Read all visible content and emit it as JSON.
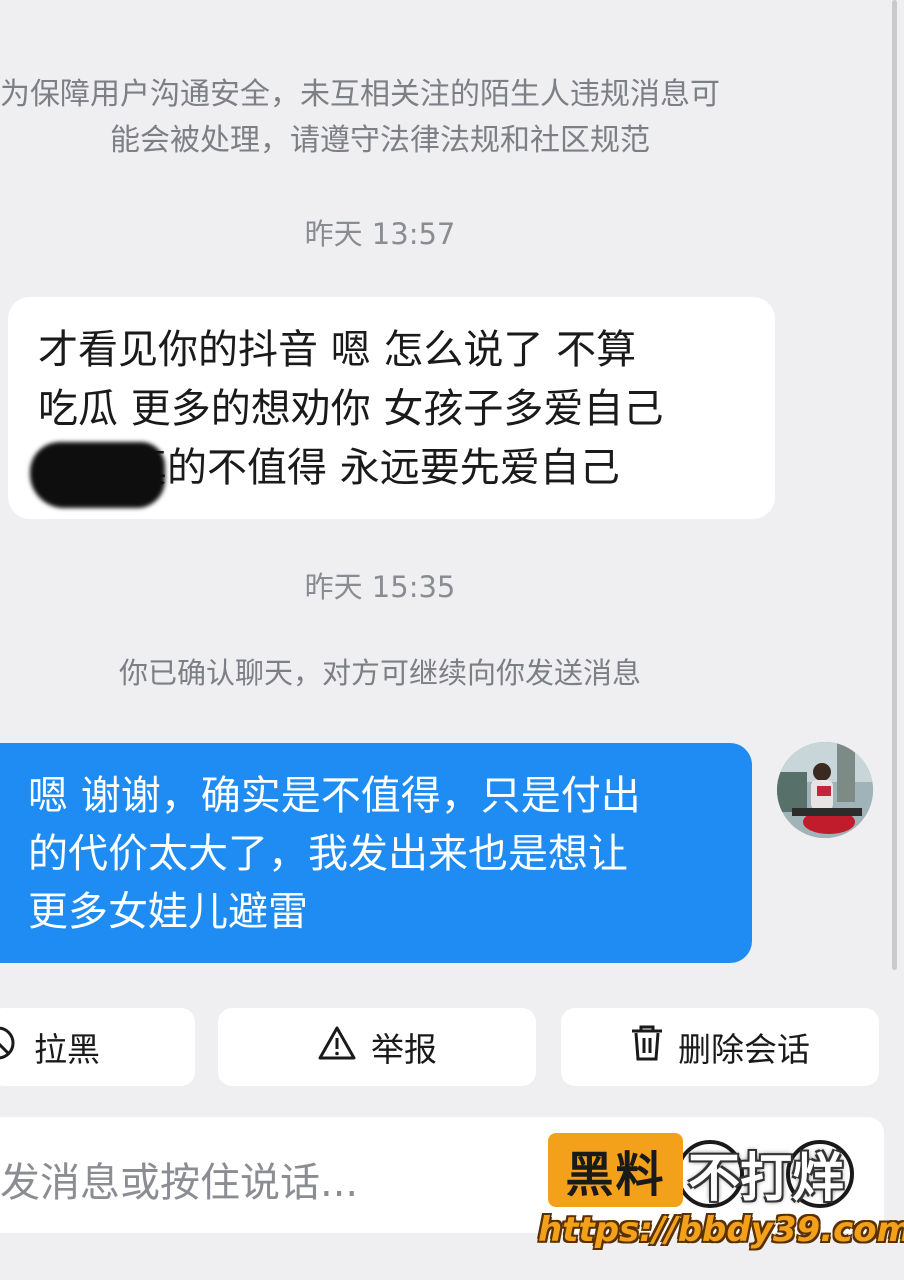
{
  "notice": {
    "line1": "为保障用户沟通安全，未互相关注的陌生人违规消息可",
    "line2": "能会被处理，请遵守法律法规和社区规范"
  },
  "messages": [
    {
      "timestamp": "昨天 13:57",
      "lines": [
        "才看见你的抖音 嗯 怎么说了 不算",
        "吃瓜 更多的想劝你 女孩子多爱自己",
        "       真的不值得 永远要先爱自己"
      ]
    },
    {
      "timestamp": "昨天 15:35",
      "system": "你已确认聊天，对方可继续向你发送消息",
      "lines": [
        "嗯 谢谢，确实是不值得，只是付出",
        "的代价太大了，我发出来也是想让",
        "更多女娃儿避雷"
      ]
    }
  ],
  "actions": {
    "block": "拉黑",
    "report": "举报",
    "delete": "删除会话"
  },
  "input": {
    "placeholder": "发消息或按住说话..."
  },
  "watermark": {
    "badge": "黑料",
    "text": "不打烊",
    "url": "https://bbdy39.com"
  },
  "colors": {
    "background": "#efeff1",
    "outgoing_bubble": "#1e8cf3",
    "incoming_bubble": "#ffffff",
    "watermark_orange": "#f3a11a"
  },
  "icons": [
    "block-icon",
    "warning-icon",
    "trash-icon",
    "emoji-icon",
    "plus-icon"
  ]
}
